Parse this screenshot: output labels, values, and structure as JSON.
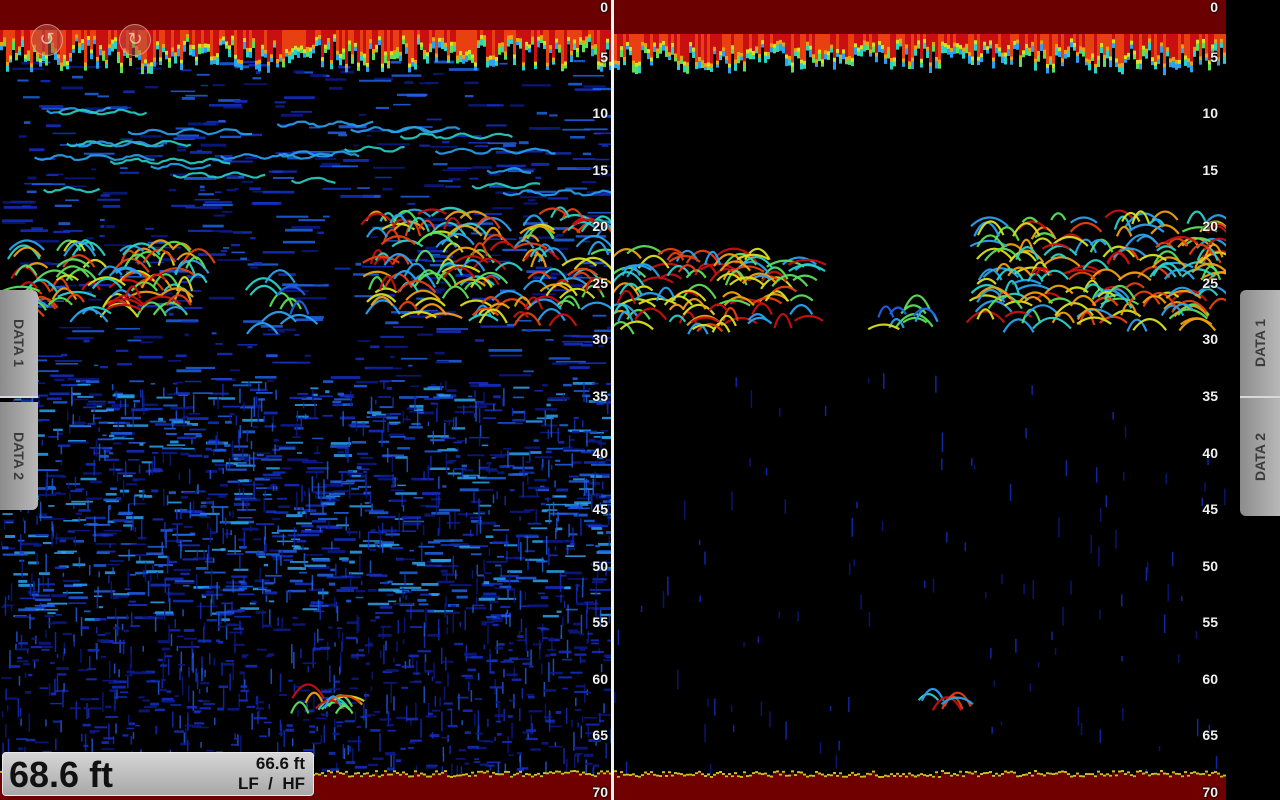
{
  "colors": {
    "surface": "#6b0000",
    "bottom": "#700000",
    "background": "#000000",
    "divider": "#f2f2f2",
    "scale_text": "#f0f0f0"
  },
  "depth_scale": {
    "unit": "ft",
    "ticks": [
      "0",
      "5",
      "10",
      "15",
      "20",
      "25",
      "30",
      "35",
      "40",
      "45",
      "50",
      "55",
      "60",
      "65",
      "70"
    ],
    "max_depth": 70
  },
  "left_pane": {
    "frequency": "LF",
    "controls": {
      "button_a_icon": "undo-icon",
      "button_b_icon": "redo-icon"
    }
  },
  "right_pane": {
    "frequency": "HF"
  },
  "tabs": {
    "left": [
      "DATA 1",
      "DATA 2"
    ],
    "right": [
      "DATA 1",
      "DATA 2"
    ]
  },
  "depth_readout": {
    "primary": "68.6 ft",
    "secondary": "66.6 ft",
    "frequency_label": "LF  /  HF"
  }
}
